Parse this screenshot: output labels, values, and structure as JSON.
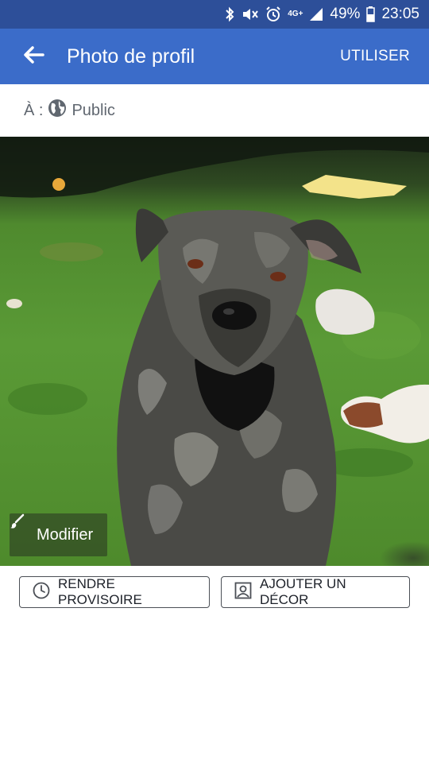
{
  "status_bar": {
    "network": "4G+",
    "battery": "49%",
    "time": "23:05"
  },
  "app_bar": {
    "title": "Photo de profil",
    "use_label": "UTILISER"
  },
  "audience": {
    "prefix": "À :",
    "value": "Public"
  },
  "photo": {
    "modify_label": "Modifier"
  },
  "actions": {
    "temporary_label": "RENDRE PROVISOIRE",
    "frame_label": "AJOUTER UN DÉCOR"
  },
  "colors": {
    "status_bar": "#2d4f99",
    "app_bar": "#3b6cc9",
    "text_secondary": "#606770"
  },
  "icons": [
    "bluetooth-icon",
    "mute-icon",
    "alarm-icon",
    "signal-icon",
    "battery-icon",
    "back-arrow-icon",
    "globe-icon",
    "brush-icon",
    "clock-icon",
    "profile-frame-icon"
  ]
}
